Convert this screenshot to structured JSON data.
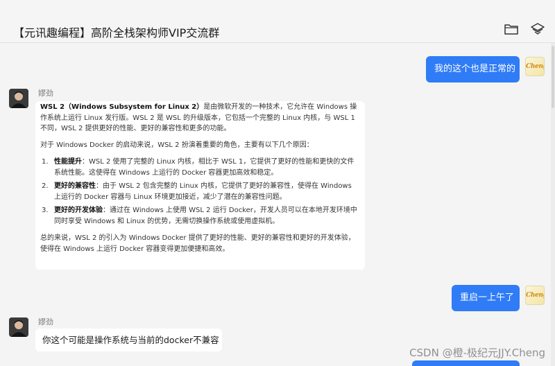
{
  "header": {
    "title": "【元讯趣编程】高阶全栈架构师VIP交流群",
    "icons": [
      "folder-icon",
      "shield-icon"
    ]
  },
  "messages": [
    {
      "side": "right",
      "avatar_text": "Cheng",
      "text": "我的这个也是正常的"
    },
    {
      "side": "left",
      "sender": "嫪劲",
      "doc": {
        "intro_bold": "WSL 2（Windows Subsystem for Linux 2）",
        "intro_rest": "是由微软开发的一种技术，它允许在 Windows 操作系统上运行 Linux 发行版。WSL 2 是 WSL 的升级版本，它包括一个完整的 Linux 内核，与 WSL 1 不同，WSL 2 提供更好的性能、更好的兼容性和更多的功能。",
        "para2": "对于 Windows Docker 的启动来说，WSL 2 扮演着重要的角色，主要有以下几个原因：",
        "items": [
          {
            "num": "1.",
            "bold": "性能提升",
            "text": "：WSL 2 使用了完整的 Linux 内核，相比于 WSL 1，它提供了更好的性能和更快的文件系统性能。这使得在 Windows 上运行的 Docker 容器更加高效和稳定。"
          },
          {
            "num": "2.",
            "bold": "更好的兼容性",
            "text": "：由于 WSL 2 包含完整的 Linux 内核，它提供了更好的兼容性，使得在 Windows 上运行的 Docker 容器与 Linux 环境更加接近，减少了潜在的兼容性问题。"
          },
          {
            "num": "3.",
            "bold": "更好的开发体验",
            "text": "：通过在 Windows 上使用 WSL 2 运行 Docker，开发人员可以在本地开发环境中同时享受 Windows 和 Linux 的优势，无需切换操作系统或使用虚拟机。"
          }
        ],
        "conclusion": "总的来说，WSL 2 的引入为 Windows Docker 提供了更好的性能、更好的兼容性和更好的开发体验，使得在 Windows 上运行 Docker 容器变得更加便捷和高效。"
      }
    },
    {
      "side": "right",
      "avatar_text": "Cheng",
      "text": "重启一上午了"
    },
    {
      "side": "left",
      "sender": "嫪劲",
      "text": "你这个可能是操作系统与当前的docker不兼容"
    }
  ],
  "watermark": "CSDN @橙-极纪元JJY.Cheng",
  "colors": {
    "bubble_blue": "#2f7cf6",
    "background": "#f4f4f4",
    "bubble_white": "#ffffff"
  }
}
